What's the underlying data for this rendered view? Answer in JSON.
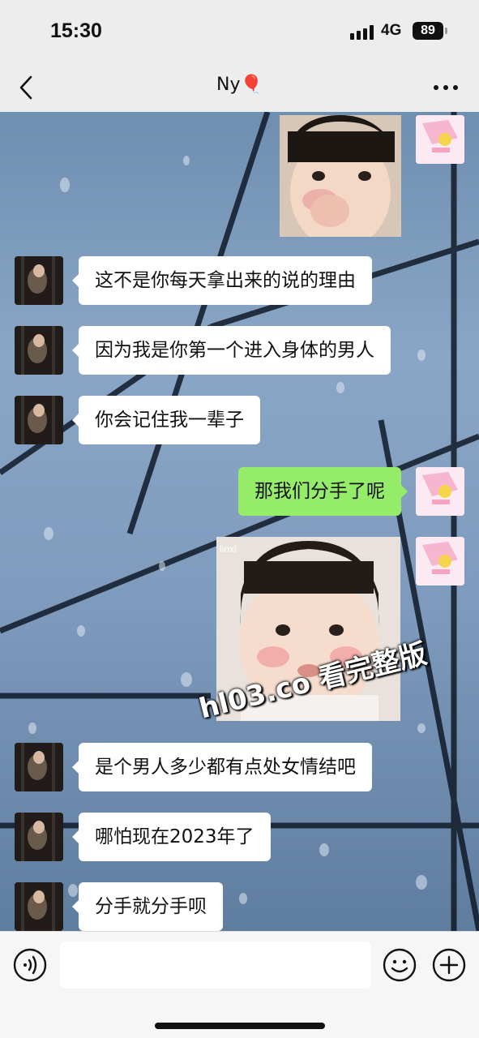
{
  "status_bar": {
    "time": "15:30",
    "network": "4G",
    "battery": "89"
  },
  "nav": {
    "title": "Ny",
    "title_emoji": "🎈"
  },
  "messages": [
    {
      "from": "self",
      "type": "sticker",
      "desc": "toddler rubbing eye"
    },
    {
      "from": "peer",
      "type": "text",
      "text": "这不是你每天拿出来的说的理由"
    },
    {
      "from": "peer",
      "type": "text",
      "text": "因为我是你第一个进入身体的男人"
    },
    {
      "from": "peer",
      "type": "text",
      "text": "你会记住我一辈子"
    },
    {
      "from": "self",
      "type": "text",
      "text": "那我们分手了呢"
    },
    {
      "from": "self",
      "type": "sticker",
      "desc": "toddler pouting",
      "caption": "linxi"
    },
    {
      "from": "peer",
      "type": "text",
      "text": "是个男人多少都有点处女情结吧"
    },
    {
      "from": "peer",
      "type": "text",
      "text": "哪怕现在2023年了"
    },
    {
      "from": "peer",
      "type": "text",
      "text": "分手就分手呗"
    }
  ],
  "watermark": "hl03.co 看完整版",
  "colors": {
    "self_bubble": "#95ec69",
    "peer_bubble": "#ffffff",
    "nav_bg": "#ededed"
  },
  "icons": {
    "back": "chevron-left-icon",
    "more": "more-dots-icon",
    "voice": "voice-icon",
    "emoji": "emoji-icon",
    "plus": "plus-icon"
  }
}
